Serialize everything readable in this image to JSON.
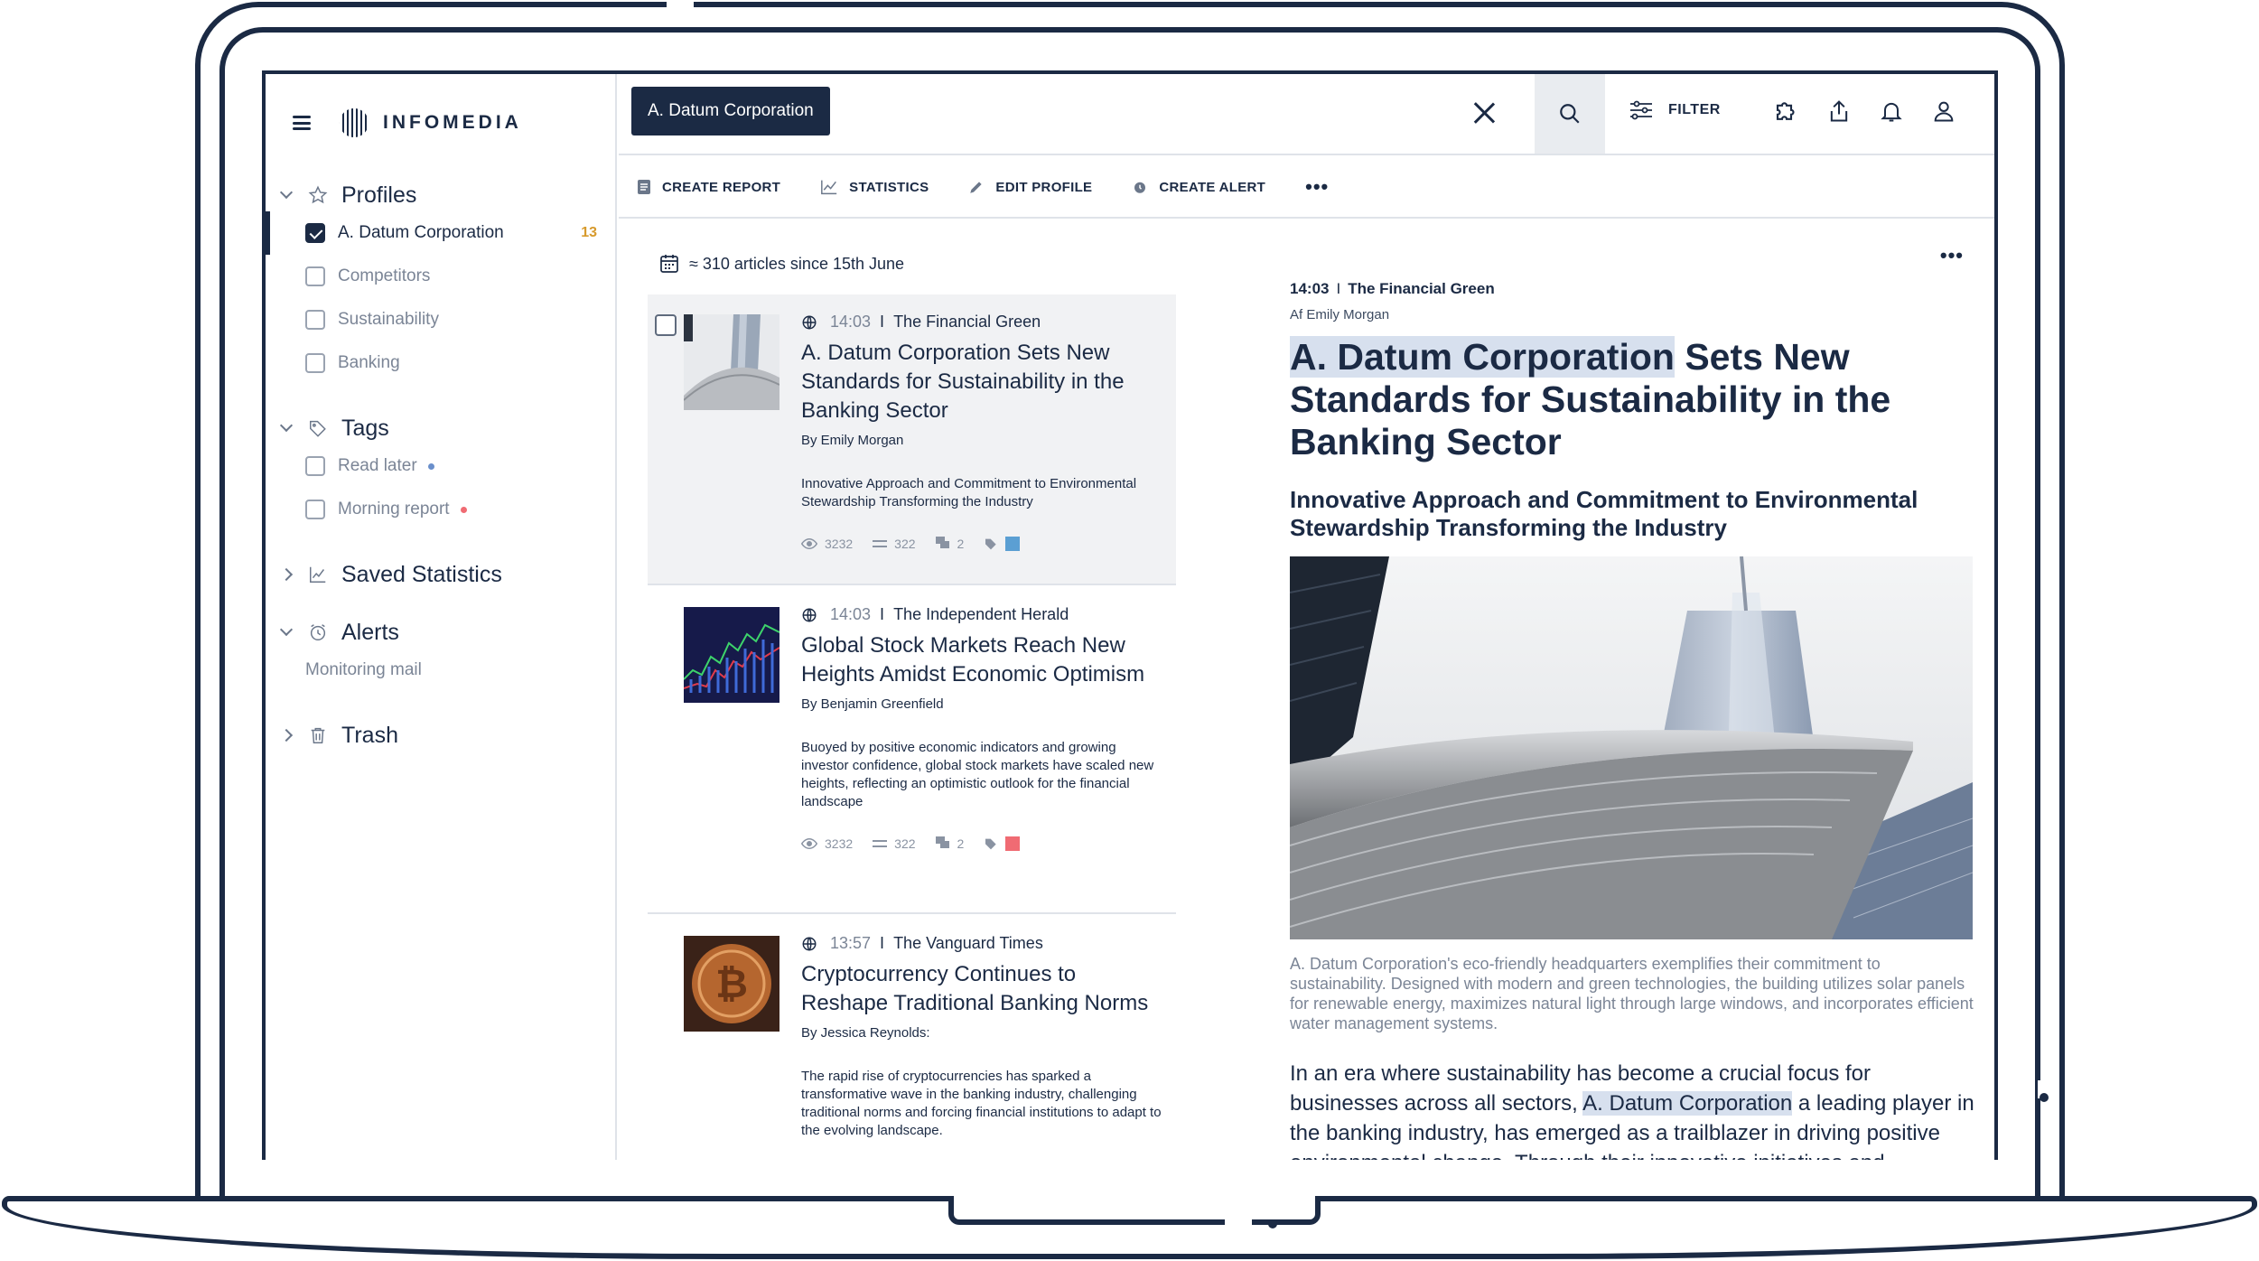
{
  "brand": {
    "name": "INFOMEDIA"
  },
  "search": {
    "query": "A. Datum Corporation"
  },
  "topbar": {
    "filter_label": "FILTER"
  },
  "toolbar": {
    "create_report": "CREATE REPORT",
    "statistics": "STATISTICS",
    "edit_profile": "EDIT PROFILE",
    "create_alert": "CREATE ALERT",
    "more": "•••"
  },
  "sidebar": {
    "profiles": {
      "title": "Profiles",
      "items": [
        {
          "label": "A. Datum Corporation",
          "checked": true,
          "count": "13"
        },
        {
          "label": "Competitors",
          "checked": false
        },
        {
          "label": "Sustainability",
          "checked": false
        },
        {
          "label": "Banking",
          "checked": false
        }
      ]
    },
    "tags": {
      "title": "Tags",
      "items": [
        {
          "label": "Read later",
          "color": "#6a8fcb"
        },
        {
          "label": "Morning report",
          "color": "#f06b73"
        }
      ]
    },
    "saved_statistics": {
      "title": "Saved Statistics"
    },
    "alerts": {
      "title": "Alerts",
      "items": [
        {
          "label": "Monitoring mail"
        }
      ]
    },
    "trash": {
      "title": "Trash"
    }
  },
  "list": {
    "meta": "≈ 310 articles since 15th June",
    "articles": [
      {
        "time": "14:03",
        "source": "The Financial Green",
        "title": "A. Datum Corporation Sets New Standards for Sustainability in the Banking Sector",
        "byline": "By Emily Morgan",
        "summary": "Innovative Approach and Commitment to Environmental Stewardship Transforming the Industry",
        "views": "3232",
        "comments": "322",
        "shares": "2",
        "tag_color": "#5b9fd3"
      },
      {
        "time": "14:03",
        "source": "The Independent Herald",
        "title": "Global Stock Markets Reach New Heights Amidst Economic Optimism",
        "byline": "By Benjamin Greenfield",
        "summary": "Buoyed by positive economic indicators and growing investor confidence, global stock markets have scaled new heights, reflecting an optimistic outlook for the financial landscape",
        "views": "3232",
        "comments": "322",
        "shares": "2",
        "tag_color": "#f06b73"
      },
      {
        "time": "13:57",
        "source": "The Vanguard Times",
        "title": "Cryptocurrency Continues to Reshape Traditional Banking Norms",
        "byline": "By Jessica Reynolds:",
        "summary": "The rapid rise of cryptocurrencies has sparked a transformative wave in the banking industry, challenging traditional norms and forcing financial institutions to adapt to the evolving landscape."
      }
    ]
  },
  "reader": {
    "more": "•••",
    "time": "14:03",
    "source": "The Financial Green",
    "byline": "Af Emily Morgan",
    "title_highlight": "A. Datum Corporation",
    "title_rest": " Sets New Standards for Sustainability in the Banking Sector",
    "subtitle": "Innovative Approach and Commitment to Environmental Stewardship Transforming the Industry",
    "caption": "A. Datum Corporation's eco-friendly headquarters exemplifies their commitment to sustainability. Designed with modern and green technologies, the building utilizes solar panels for renewable energy, maximizes natural light through large windows, and incorporates efficient water management systems.",
    "body_pre": "In an era where sustainability has become a crucial focus for businesses across all sectors, ",
    "body_highlight": "A. Datum Corporation",
    "body_post": " a leading player in the banking industry, has emerged as a trailblazer in driving positive environmental change. Through their innovative initiatives and"
  }
}
